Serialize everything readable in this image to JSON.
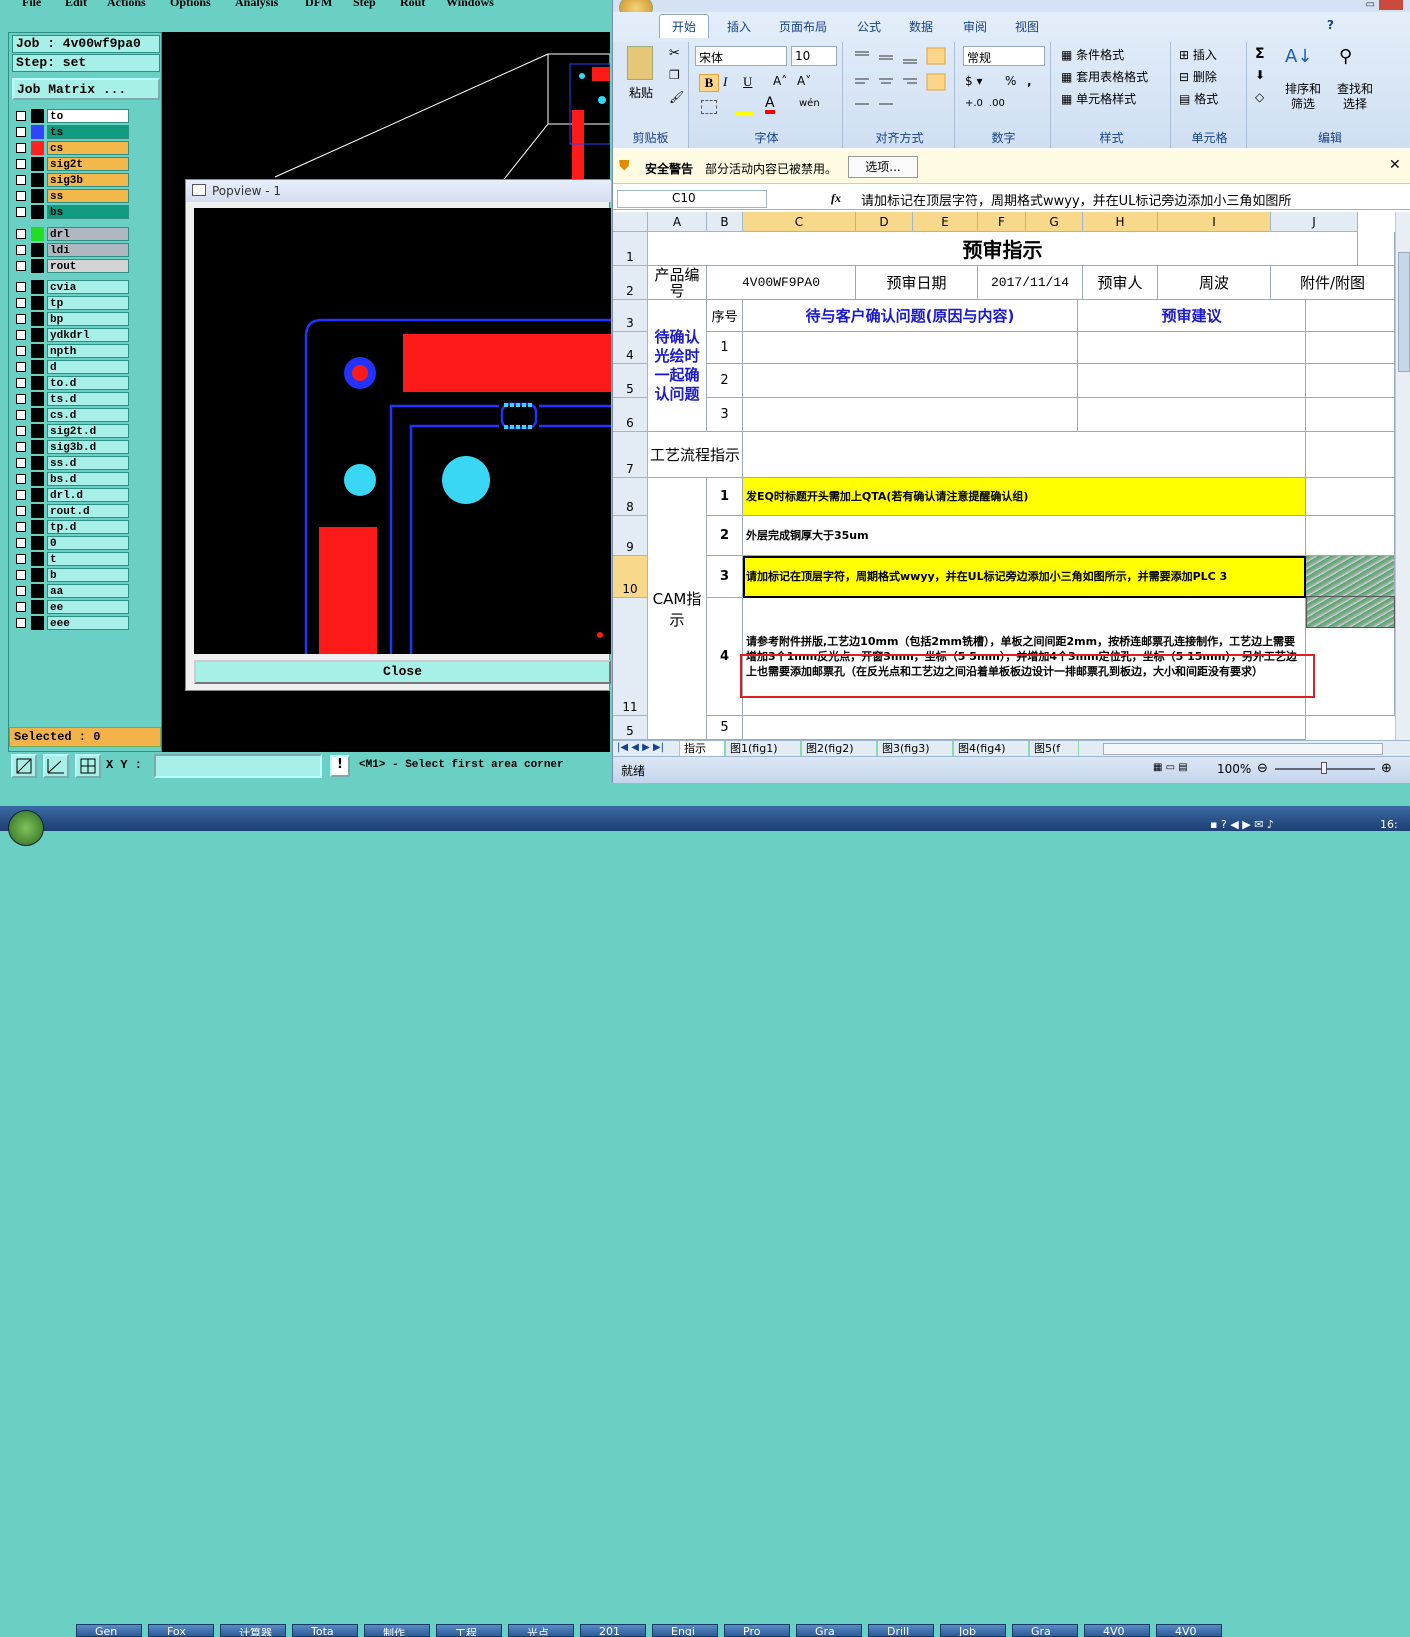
{
  "genesis": {
    "menu": [
      "File",
      "Edit",
      "Actions",
      "Options",
      "Analysis",
      "DFM",
      "Step",
      "Rout",
      "Windows"
    ],
    "job": "Job : 4v00wf9pa0",
    "step": "Step: set",
    "job_matrix": "Job Matrix ...",
    "layers": [
      {
        "name": "to",
        "color": "#ffffff",
        "swatch": "#000000"
      },
      {
        "name": "ts",
        "color": "#119a7e",
        "swatch": "#3344ff"
      },
      {
        "name": "cs",
        "color": "#f2b84a",
        "swatch": "#ff2020"
      },
      {
        "name": "sig2t",
        "color": "#f2b84a",
        "swatch": "#000000"
      },
      {
        "name": "sig3b",
        "color": "#f2b84a",
        "swatch": "#000000"
      },
      {
        "name": "ss",
        "color": "#f2b84a",
        "swatch": "#000000"
      },
      {
        "name": "bs",
        "color": "#119a7e",
        "swatch": "#000000"
      }
    ],
    "drill_layers": [
      {
        "name": "drl",
        "color": "#b0b8bf",
        "swatch": "#22dd22"
      },
      {
        "name": "ldi",
        "color": "#b0b8bf",
        "swatch": "#000000"
      },
      {
        "name": "rout",
        "color": "#d4d4d4",
        "swatch": "#000000"
      }
    ],
    "misc_layers": [
      "cvia",
      "tp",
      "bp",
      "ydkdrl",
      "npth",
      "d",
      "to.d",
      "ts.d",
      "cs.d",
      "sig2t.d",
      "sig3b.d",
      "ss.d",
      "bs.d",
      "drl.d",
      "rout.d",
      "tp.d",
      "0",
      "t",
      "b",
      "aa",
      "ee",
      "eee"
    ],
    "selected": "Selected : 0",
    "xy_label": "X Y :",
    "status": "<M1> - Select first area corner",
    "popview_title": "Popview - 1",
    "close": "Close"
  },
  "excel": {
    "tabs": [
      "开始",
      "插入",
      "页面布局",
      "公式",
      "数据",
      "审阅",
      "视图"
    ],
    "font_name": "宋体",
    "font_size": "10",
    "number_format": "常规",
    "groups": {
      "clipboard": "剪贴板",
      "font": "字体",
      "align": "对齐方式",
      "number": "数字",
      "styles": "样式",
      "cells": "单元格",
      "edit": "编辑"
    },
    "paste": "粘贴",
    "style_items": [
      "条件格式",
      "套用表格格式",
      "单元格样式"
    ],
    "cell_items": [
      "插入",
      "删除",
      "格式"
    ],
    "edit_items": [
      "排序和筛选",
      "查找和选择"
    ],
    "security": "安全警告",
    "security_msg": "部分活动内容已被禁用。",
    "options": "选项...",
    "name_box": "C10",
    "formula": "请加标记在顶层字符，周期格式wwyy，并在UL标记旁边添加小三角如图所",
    "cols": [
      "A",
      "B",
      "C",
      "D",
      "E",
      "F",
      "G",
      "H",
      "I",
      "J"
    ],
    "title": "预审指示",
    "r2": {
      "a": "产品编号",
      "val": "4V00WF9PA0",
      "date_l": "预审日期",
      "date": "2017/11/14",
      "rev_l": "预审人",
      "rev": "周波",
      "att": "附件/附图"
    },
    "r3": {
      "seq": "序号",
      "q": "待与客户确认问题(原因与内容)",
      "s": "预审建议"
    },
    "confirm": "待确认光绘时一起确认问题",
    "nums": [
      "1",
      "2",
      "3",
      "4",
      "5"
    ],
    "flow": "工艺流程指示",
    "cam": "CAM指示",
    "i8": "发EQ时标题开头需加上QTA(若有确认请注意提醒确认组)",
    "i9": "外层完成铜厚大于35um",
    "i10": "请加标记在顶层字符，周期格式wwyy，并在UL标记旁边添加小三角如图所示，并需要添加PLC 3",
    "i11": "请参考附件拼版,工艺边10mm（包括2mm铣槽），单板之间间距2mm，按桥连邮票孔连接制作，工艺边上需要增加3个1mm反光点，开窗3mm，坐标（5 5mm），并增加4个3mm定位孔，坐标（5 15mm），另外工艺边上也需要添加邮票孔（在反光点和工艺边之间沿着单板板边设计一排邮票孔到板边，大小和间距没有要求）",
    "sheets": [
      "指示",
      "图1(fig1)",
      "图2(fig2)",
      "图3(fig3)",
      "图4(fig4)",
      "图5(f"
    ],
    "ready": "就绪",
    "zoom": "100%"
  },
  "taskbar": [
    "Gen",
    "Fox",
    "计算器",
    "Tota",
    "制作",
    "工程",
    "光点",
    "201",
    "Engi",
    "Pro",
    "Gra",
    "Drill",
    "Job",
    "Gra",
    "4V0",
    "4V0"
  ],
  "clock": "16:"
}
